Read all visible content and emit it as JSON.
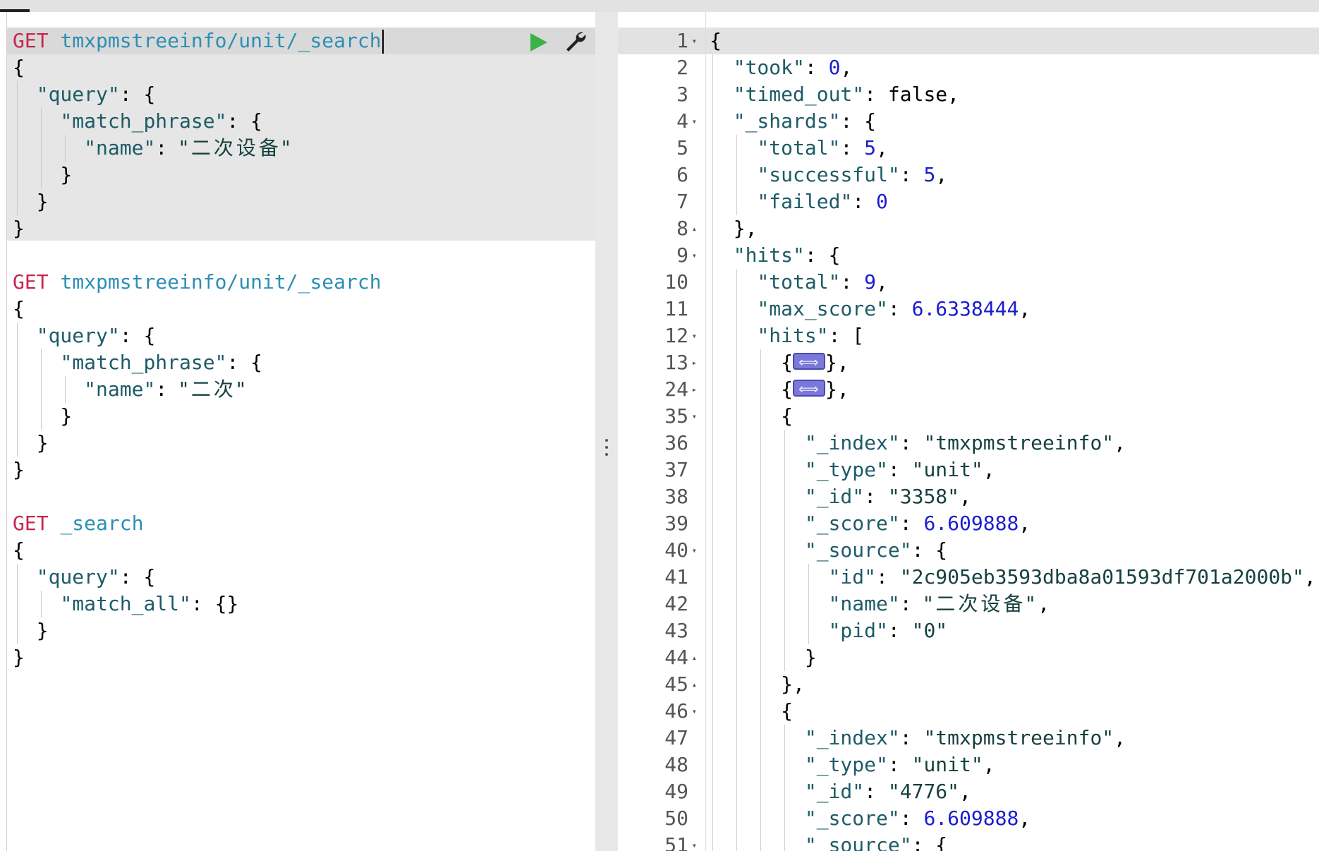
{
  "requests": [
    {
      "method": "GET",
      "url": "tmxpmstreeinfo/unit/_search",
      "body": [
        "{",
        "  \"query\": {",
        "    \"match_phrase\": {",
        "      \"name\": \"二次设备\"",
        "    }",
        "  }",
        "}"
      ]
    },
    {
      "method": "GET",
      "url": "tmxpmstreeinfo/unit/_search",
      "body": [
        "{",
        "  \"query\": {",
        "    \"match_phrase\": {",
        "      \"name\": \"二次\"",
        "    }",
        "  }",
        "}"
      ]
    },
    {
      "method": "GET",
      "url": "_search",
      "body": [
        "{",
        "  \"query\": {",
        "    \"match_all\": {}",
        "  }",
        "}"
      ]
    }
  ],
  "toolbar": {
    "run_icon": "play-icon",
    "settings_icon": "wrench-icon"
  },
  "response": {
    "lines": [
      {
        "n": "1",
        "fold": "▾",
        "text": "{"
      },
      {
        "n": "2",
        "fold": "",
        "text": "  \"took\": 0,"
      },
      {
        "n": "3",
        "fold": "",
        "text": "  \"timed_out\": false,"
      },
      {
        "n": "4",
        "fold": "▾",
        "text": "  \"_shards\": {"
      },
      {
        "n": "5",
        "fold": "",
        "text": "    \"total\": 5,"
      },
      {
        "n": "6",
        "fold": "",
        "text": "    \"successful\": 5,"
      },
      {
        "n": "7",
        "fold": "",
        "text": "    \"failed\": 0"
      },
      {
        "n": "8",
        "fold": "▴",
        "text": "  },"
      },
      {
        "n": "9",
        "fold": "▾",
        "text": "  \"hits\": {"
      },
      {
        "n": "10",
        "fold": "",
        "text": "    \"total\": 9,"
      },
      {
        "n": "11",
        "fold": "",
        "text": "    \"max_score\": 6.6338444,"
      },
      {
        "n": "12",
        "fold": "▾",
        "text": "    \"hits\": ["
      },
      {
        "n": "13",
        "fold": "▸",
        "text": "      {⟺},"
      },
      {
        "n": "24",
        "fold": "▸",
        "text": "      {⟺},"
      },
      {
        "n": "35",
        "fold": "▾",
        "text": "      {"
      },
      {
        "n": "36",
        "fold": "",
        "text": "        \"_index\": \"tmxpmstreeinfo\","
      },
      {
        "n": "37",
        "fold": "",
        "text": "        \"_type\": \"unit\","
      },
      {
        "n": "38",
        "fold": "",
        "text": "        \"_id\": \"3358\","
      },
      {
        "n": "39",
        "fold": "",
        "text": "        \"_score\": 6.609888,"
      },
      {
        "n": "40",
        "fold": "▾",
        "text": "        \"_source\": {"
      },
      {
        "n": "41",
        "fold": "",
        "text": "          \"id\": \"2c905eb3593dba8a01593df701a2000b\","
      },
      {
        "n": "42",
        "fold": "",
        "text": "          \"name\": \"二次设备\","
      },
      {
        "n": "43",
        "fold": "",
        "text": "          \"pid\": \"0\""
      },
      {
        "n": "44",
        "fold": "▴",
        "text": "        }"
      },
      {
        "n": "45",
        "fold": "▴",
        "text": "      },"
      },
      {
        "n": "46",
        "fold": "▾",
        "text": "      {"
      },
      {
        "n": "47",
        "fold": "",
        "text": "        \"_index\": \"tmxpmstreeinfo\","
      },
      {
        "n": "48",
        "fold": "",
        "text": "        \"_type\": \"unit\","
      },
      {
        "n": "49",
        "fold": "",
        "text": "        \"_id\": \"4776\","
      },
      {
        "n": "50",
        "fold": "",
        "text": "        \"_score\": 6.609888,"
      },
      {
        "n": "51",
        "fold": "▾",
        "text": "        \"_source\": {"
      }
    ]
  }
}
